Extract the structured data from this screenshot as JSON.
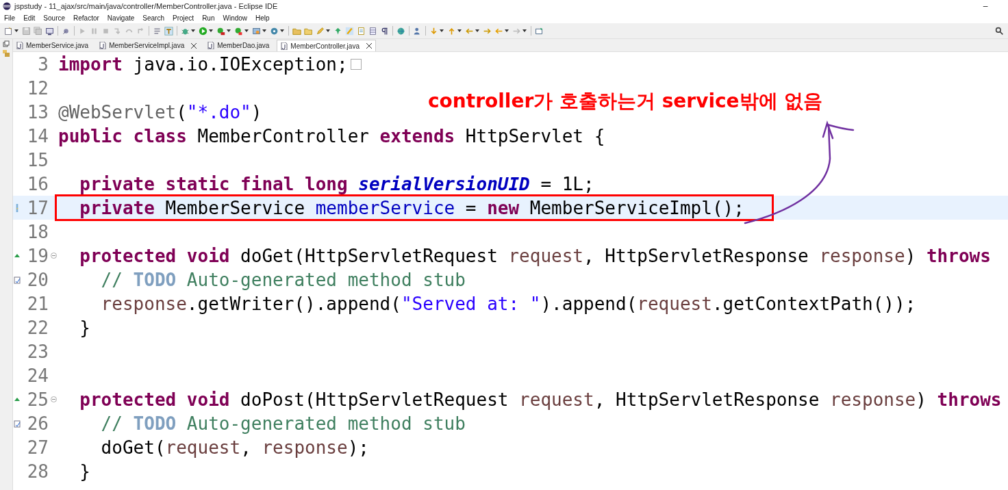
{
  "window": {
    "title": "jspstudy - 11_ajax/src/main/java/controller/MemberController.java - Eclipse IDE",
    "controls": [
      "–"
    ]
  },
  "menu": [
    "File",
    "Edit",
    "Source",
    "Refactor",
    "Navigate",
    "Search",
    "Project",
    "Run",
    "Window",
    "Help"
  ],
  "tabs": [
    {
      "label": "MemberService.java",
      "selected": false,
      "close": false
    },
    {
      "label": "MemberServiceImpl.java",
      "selected": false,
      "close": true
    },
    {
      "label": "MemberDao.java",
      "selected": false,
      "close": false
    },
    {
      "label": "MemberController.java",
      "selected": true,
      "close": true
    }
  ],
  "editor": {
    "lines": [
      {
        "number": "3",
        "boxed": false,
        "current": false,
        "icons": [
          {
            "kind": "folded"
          }
        ],
        "tokens": [
          {
            "kind": "kw",
            "text": "import"
          },
          {
            "kind": "plain",
            "text": " java.io.IOException;"
          }
        ]
      },
      {
        "number": "12",
        "boxed": false,
        "current": false
      },
      {
        "number": "13",
        "boxed": false,
        "current": false,
        "tokens": [
          {
            "kind": "annotation",
            "text": "@WebServlet"
          },
          {
            "kind": "plain",
            "text": "("
          },
          {
            "kind": "str",
            "text": "\"*.do\""
          },
          {
            "kind": "plain",
            "text": ")"
          }
        ]
      },
      {
        "number": "14",
        "boxed": false,
        "current": false,
        "tokens": [
          {
            "kind": "kw",
            "text": "public class"
          },
          {
            "kind": "plain",
            "text": " MemberController "
          },
          {
            "kind": "kw",
            "text": "extends"
          },
          {
            "kind": "plain",
            "text": " HttpServlet {"
          }
        ]
      },
      {
        "number": "15",
        "boxed": false,
        "current": false
      },
      {
        "number": "16",
        "boxed": false,
        "current": false,
        "tokens": [
          {
            "kind": "kw",
            "text": "  private static final long"
          },
          {
            "kind": "static_field",
            "text": " serialVersionUID"
          },
          {
            "kind": "plain",
            "text": " = 1L;"
          }
        ]
      },
      {
        "number": "17",
        "boxed": true,
        "current": true,
        "icons": [
          {
            "kind": "quickfix"
          }
        ],
        "tokens": [
          {
            "kind": "kw",
            "text": "  private"
          },
          {
            "kind": "plain",
            "text": " MemberService "
          },
          {
            "kind": "field",
            "text": "memberService"
          },
          {
            "kind": "plain",
            "text": " = "
          },
          {
            "kind": "kw",
            "text": "new"
          },
          {
            "kind": "plain",
            "text": " MemberServiceImpl();"
          }
        ]
      },
      {
        "number": "18",
        "boxed": false,
        "current": false
      },
      {
        "number": "19",
        "boxed": false,
        "current": false,
        "icons": [
          {
            "kind": "override"
          },
          {
            "kind": "collapse"
          }
        ],
        "tokens": [
          {
            "kind": "kw",
            "text": "  protected void"
          },
          {
            "kind": "plain",
            "text": " doGet(HttpServletRequest "
          },
          {
            "kind": "param",
            "text": "request"
          },
          {
            "kind": "plain",
            "text": ", HttpServletResponse "
          },
          {
            "kind": "param",
            "text": "response"
          },
          {
            "kind": "plain",
            "text": ") "
          },
          {
            "kind": "kw",
            "text": "throws"
          }
        ]
      },
      {
        "number": "20",
        "boxed": false,
        "current": false,
        "icons": [
          {
            "kind": "task"
          }
        ],
        "tokens": [
          {
            "kind": "comment",
            "text": "    // "
          },
          {
            "kind": "todo",
            "text": "TODO"
          },
          {
            "kind": "comment",
            "text": " Auto-generated method stub"
          }
        ]
      },
      {
        "number": "21",
        "boxed": false,
        "current": false,
        "tokens": [
          {
            "kind": "param",
            "text": "    response"
          },
          {
            "kind": "plain",
            "text": ".getWriter().append("
          },
          {
            "kind": "str",
            "text": "\"Served at: \""
          },
          {
            "kind": "plain",
            "text": ").append("
          },
          {
            "kind": "param",
            "text": "request"
          },
          {
            "kind": "plain",
            "text": ".getContextPath());"
          }
        ]
      },
      {
        "number": "22",
        "boxed": false,
        "current": false,
        "tokens": [
          {
            "kind": "plain",
            "text": "  }"
          }
        ]
      },
      {
        "number": "23",
        "boxed": false,
        "current": false
      },
      {
        "number": "24",
        "boxed": false,
        "current": false
      },
      {
        "number": "25",
        "boxed": false,
        "current": false,
        "icons": [
          {
            "kind": "override"
          },
          {
            "kind": "collapse"
          }
        ],
        "tokens": [
          {
            "kind": "kw",
            "text": "  protected void"
          },
          {
            "kind": "plain",
            "text": " doPost(HttpServletRequest "
          },
          {
            "kind": "param",
            "text": "request"
          },
          {
            "kind": "plain",
            "text": ", HttpServletResponse "
          },
          {
            "kind": "param",
            "text": "response"
          },
          {
            "kind": "plain",
            "text": ") "
          },
          {
            "kind": "kw",
            "text": "throws"
          }
        ]
      },
      {
        "number": "26",
        "boxed": false,
        "current": false,
        "icons": [
          {
            "kind": "task"
          }
        ],
        "tokens": [
          {
            "kind": "comment",
            "text": "    // "
          },
          {
            "kind": "todo",
            "text": "TODO"
          },
          {
            "kind": "comment",
            "text": " Auto-generated method stub"
          }
        ]
      },
      {
        "number": "27",
        "boxed": false,
        "current": false,
        "tokens": [
          {
            "kind": "plain",
            "text": "    doGet("
          },
          {
            "kind": "param",
            "text": "request"
          },
          {
            "kind": "plain",
            "text": ", "
          },
          {
            "kind": "param",
            "text": "response"
          },
          {
            "kind": "plain",
            "text": ");"
          }
        ]
      },
      {
        "number": "28",
        "boxed": false,
        "current": false,
        "tokens": [
          {
            "kind": "plain",
            "text": "  }"
          }
        ]
      }
    ]
  },
  "annotation": {
    "text": "controller가 호출하는거 service밖에 없음"
  }
}
